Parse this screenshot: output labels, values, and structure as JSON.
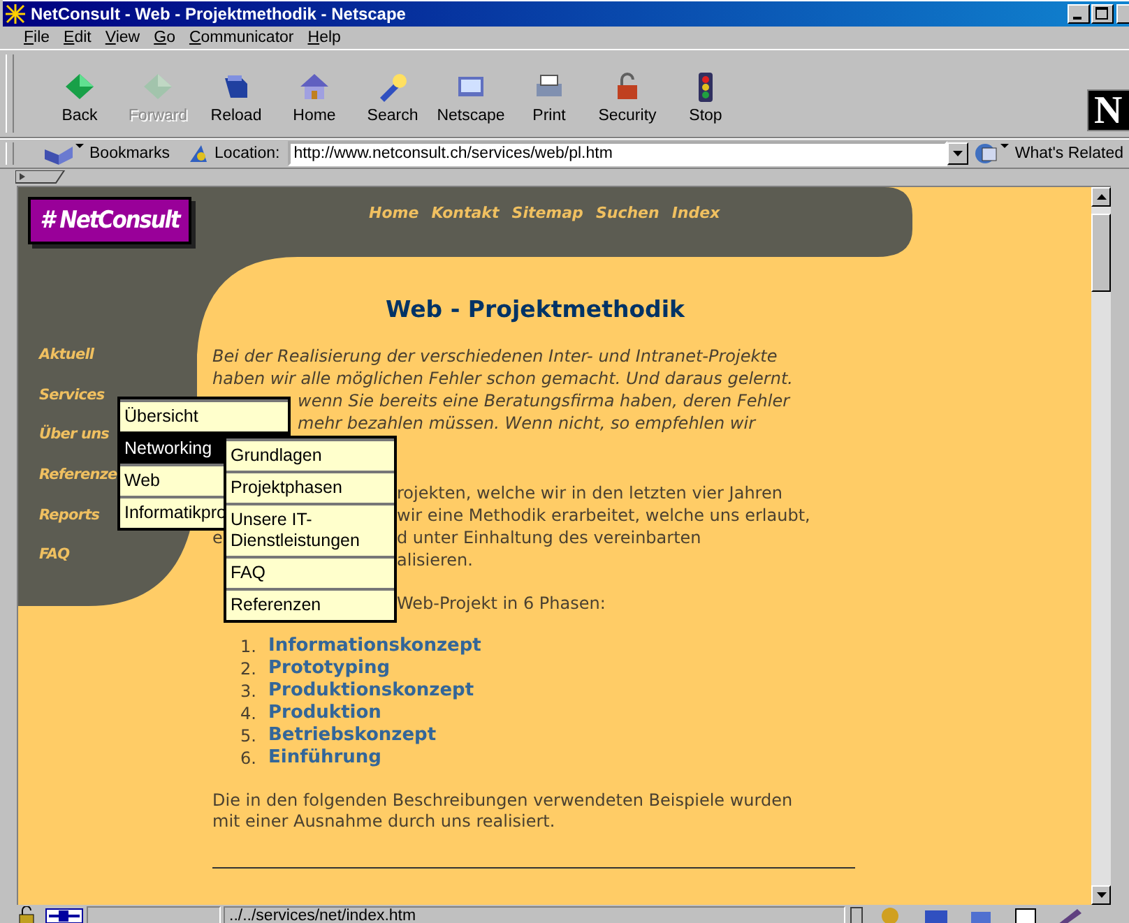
{
  "window": {
    "title": "NetConsult - Web - Projektmethodik - Netscape"
  },
  "menu_bar": [
    "File",
    "Edit",
    "View",
    "Go",
    "Communicator",
    "Help"
  ],
  "toolbar": [
    {
      "label": "Back",
      "disabled": false
    },
    {
      "label": "Forward",
      "disabled": true
    },
    {
      "label": "Reload",
      "disabled": false
    },
    {
      "label": "Home",
      "disabled": false
    },
    {
      "label": "Search",
      "disabled": false
    },
    {
      "label": "Netscape",
      "disabled": false
    },
    {
      "label": "Print",
      "disabled": false
    },
    {
      "label": "Security",
      "disabled": false
    },
    {
      "label": "Stop",
      "disabled": false
    }
  ],
  "throbber": {
    "label": "N"
  },
  "location_bar": {
    "bookmarks_label": "Bookmarks",
    "location_label": "Location:",
    "url": "http://www.netconsult.ch/services/web/pl.htm",
    "related_label": "What's Related"
  },
  "page": {
    "logo": "# NetConsult",
    "top_nav": [
      "Home",
      "Kontakt",
      "Sitemap",
      "Suchen",
      "Index"
    ],
    "side_nav": [
      "Aktuell",
      "Services",
      "Über uns",
      "Referenze",
      "Reports",
      "FAQ"
    ],
    "title": "Web - Projektmethodik",
    "paragraphs": [
      {
        "lines": [
          {
            "kind": "full",
            "text": "Bei der Realisierung der verschiedenen Inter- und Intranet-Projekte"
          },
          {
            "kind": "full",
            "text": "haben wir alle möglichen Fehler schon gemacht. Und daraus gelernt."
          },
          {
            "kind": "after_menu",
            "text": "wenn Sie bereits eine Beratungsfirma haben, deren Fehler"
          },
          {
            "kind": "after_menu",
            "text": "mehr bezahlen müssen. Wenn nicht, so empfehlen wir"
          }
        ]
      },
      {
        "lines": [
          {
            "kind": "after_submenu",
            "text": "rojekten, welche wir in den letzten vier Jahren"
          },
          {
            "kind": "after_submenu",
            "text": "wir eine Methodik erarbeitet, welche uns erlaubt,"
          },
          {
            "kind": "after_submenu",
            "left": "e",
            "text": "d unter Einhaltung des vereinbarten"
          },
          {
            "kind": "after_submenu",
            "text": "alisieren."
          }
        ]
      },
      {
        "lines": [
          {
            "kind": "after_submenu",
            "text": "Web-Projekt in 6 Phasen:"
          }
        ]
      }
    ],
    "phases": [
      {
        "number": "1.",
        "label": "Informationskonzept"
      },
      {
        "number": "2.",
        "label": "Prototyping"
      },
      {
        "number": "3.",
        "label": "Produktionskonzept"
      },
      {
        "number": "4.",
        "label": "Produktion"
      },
      {
        "number": "5.",
        "label": "Betriebskonzept"
      },
      {
        "number": "6.",
        "label": "Einführung"
      }
    ],
    "closing": [
      "Die in den folgenden Beschreibungen verwendeten Beispiele wurden",
      "mit einer Ausnahme durch uns realisiert."
    ]
  },
  "menu": {
    "items": [
      {
        "label": "Übersicht",
        "selected": false
      },
      {
        "label": "Networking",
        "selected": true
      },
      {
        "label": "Web",
        "selected": false
      },
      {
        "label": "Informatikpro",
        "selected": false
      }
    ]
  },
  "submenu": {
    "items": [
      {
        "label": "Grundlagen",
        "selected": false
      },
      {
        "label": "Projektphasen",
        "selected": false
      },
      {
        "label": "Unsere IT-Dienstleistungen",
        "selected": false
      },
      {
        "label": "FAQ",
        "selected": false
      },
      {
        "label": "Referenzen",
        "selected": false
      }
    ]
  },
  "status_bar": {
    "url": "../../services/net/index.htm"
  }
}
